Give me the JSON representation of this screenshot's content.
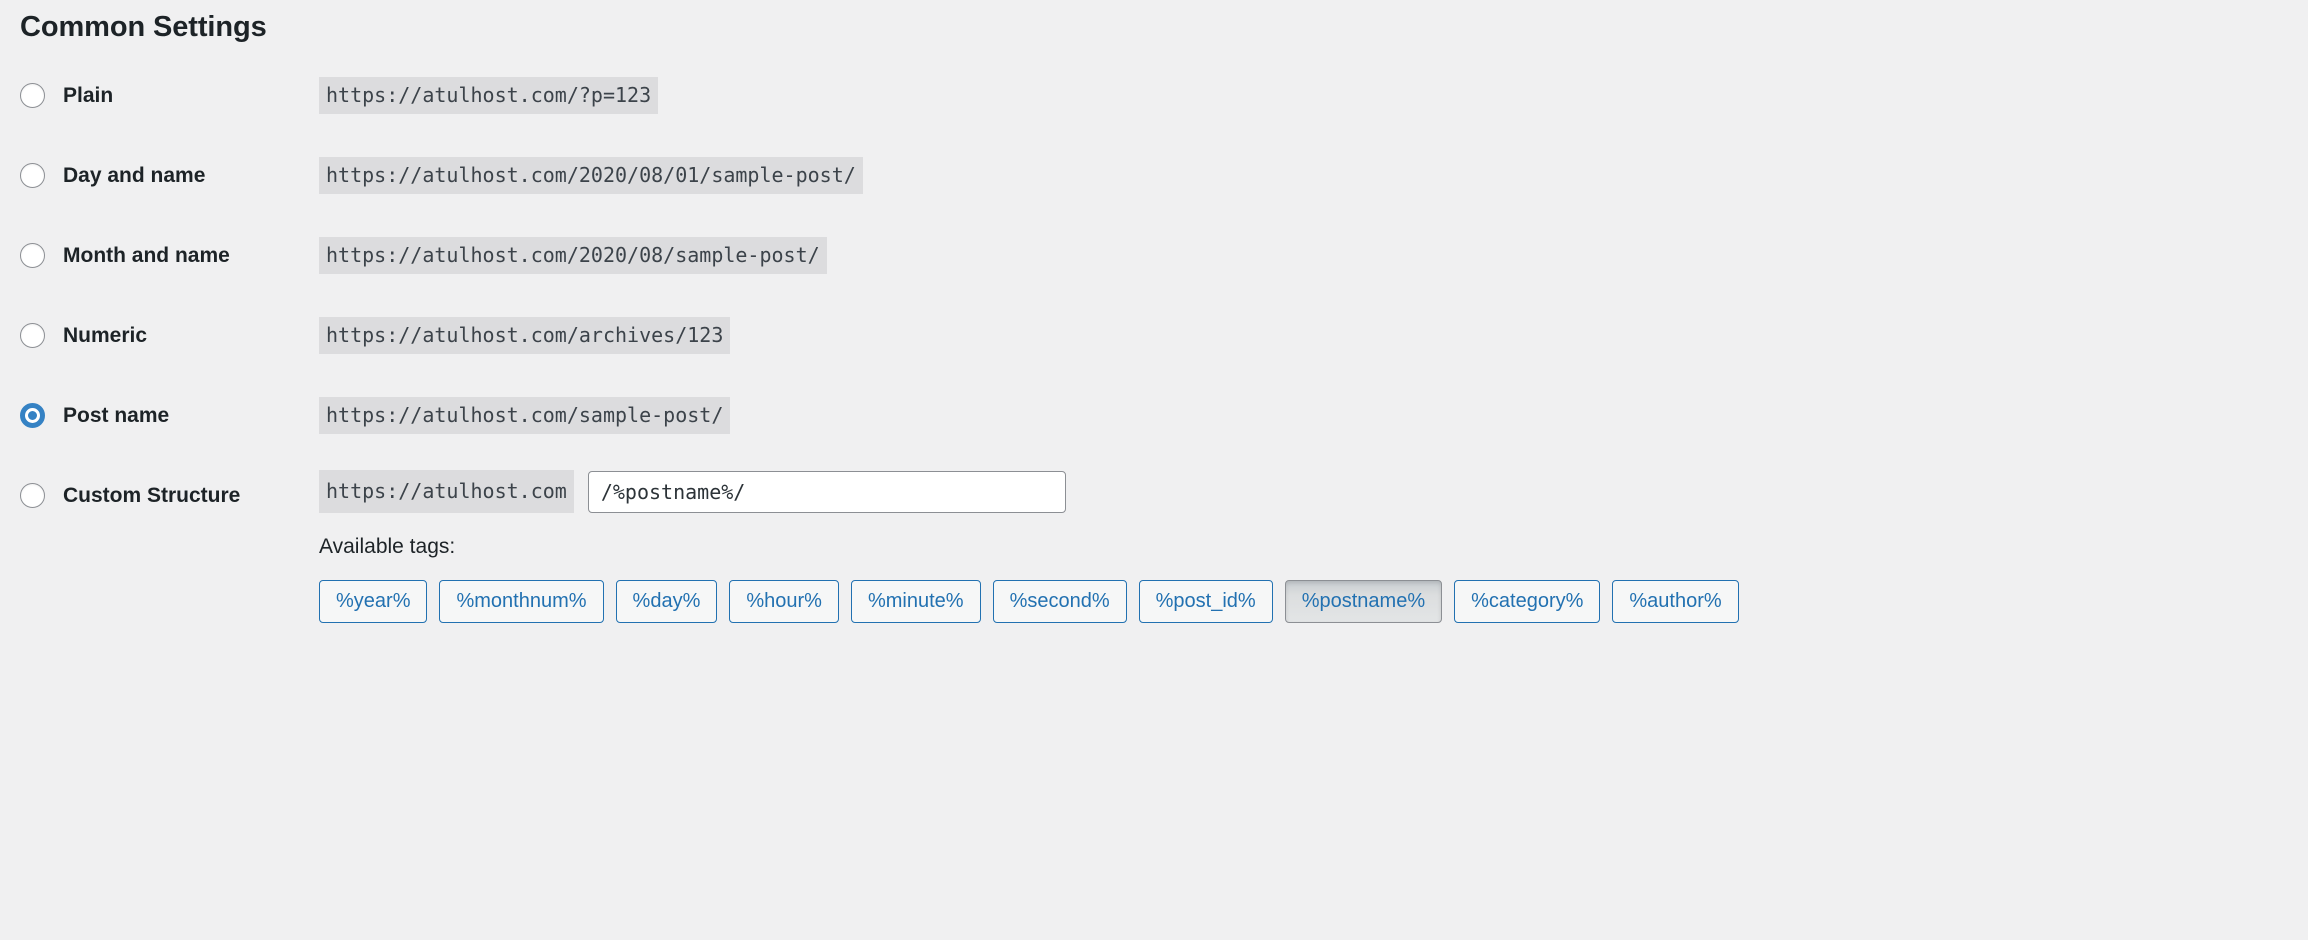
{
  "section": {
    "title": "Common Settings"
  },
  "permalink_options": [
    {
      "id": "plain",
      "label": "Plain",
      "url": "https://atulhost.com/?p=123",
      "selected": false
    },
    {
      "id": "day-and-name",
      "label": "Day and name",
      "url": "https://atulhost.com/2020/08/01/sample-post/",
      "selected": false
    },
    {
      "id": "month-and-name",
      "label": "Month and name",
      "url": "https://atulhost.com/2020/08/sample-post/",
      "selected": false
    },
    {
      "id": "numeric",
      "label": "Numeric",
      "url": "https://atulhost.com/archives/123",
      "selected": false
    },
    {
      "id": "post-name",
      "label": "Post name",
      "url": "https://atulhost.com/sample-post/",
      "selected": true
    }
  ],
  "custom_structure": {
    "label": "Custom Structure",
    "prefix": "https://atulhost.com",
    "input_value": "/%postname%/",
    "input_placeholder": "",
    "available_tags_label": "Available tags:",
    "tags": [
      {
        "label": "%year%",
        "active": false
      },
      {
        "label": "%monthnum%",
        "active": false
      },
      {
        "label": "%day%",
        "active": false
      },
      {
        "label": "%hour%",
        "active": false
      },
      {
        "label": "%minute%",
        "active": false
      },
      {
        "label": "%second%",
        "active": false
      },
      {
        "label": "%post_id%",
        "active": false
      },
      {
        "label": "%postname%",
        "active": true
      },
      {
        "label": "%category%",
        "active": false
      },
      {
        "label": "%author%",
        "active": false
      }
    ]
  },
  "colors": {
    "page_background": "#f0f0f1",
    "code_background": "#dcdcde",
    "accent_blue": "#2271b1",
    "radio_checked_blue": "#3582c4",
    "text": "#1d2327",
    "border_gray": "#8c8f94"
  }
}
